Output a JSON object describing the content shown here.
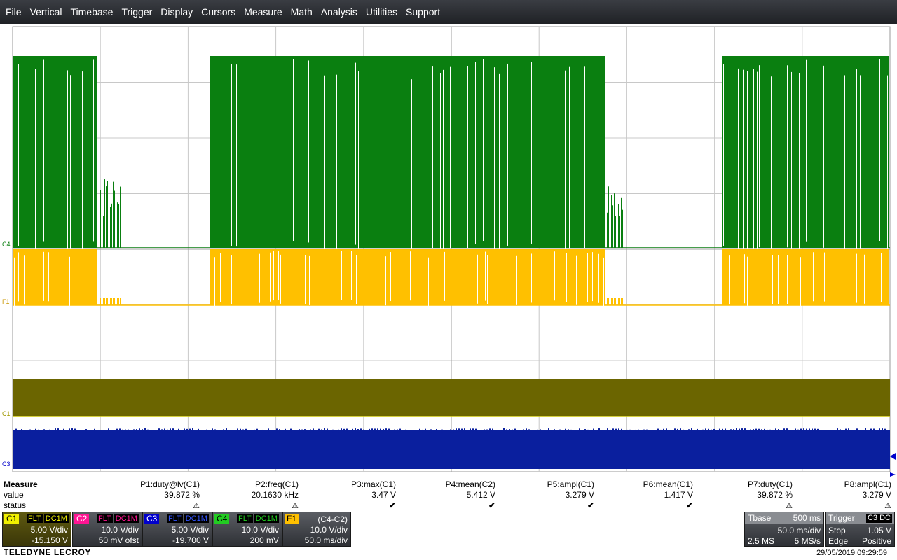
{
  "menu": [
    "File",
    "Vertical",
    "Timebase",
    "Trigger",
    "Display",
    "Cursors",
    "Measure",
    "Math",
    "Analysis",
    "Utilities",
    "Support"
  ],
  "trace_labels": {
    "c4": "C4",
    "f1": "F1",
    "c1": "C1",
    "c3": "C3"
  },
  "colors": {
    "c1": "#f0f000",
    "c2": "#ff1493",
    "c3": "#0000cc",
    "c4": "#0a7f10",
    "f1": "#ffc000",
    "olive": "#6b6500",
    "navy": "#0a1f9e"
  },
  "measure": {
    "title": "Measure",
    "value_label": "value",
    "status_label": "status",
    "params": [
      {
        "name": "P1:duty@lv(C1)",
        "value": "39.872 %",
        "status": "warn"
      },
      {
        "name": "P2:freq(C1)",
        "value": "20.1630 kHz",
        "status": "warn"
      },
      {
        "name": "P3:max(C1)",
        "value": "3.47 V",
        "status": "ok"
      },
      {
        "name": "P4:mean(C2)",
        "value": "5.412 V",
        "status": "ok"
      },
      {
        "name": "P5:ampl(C1)",
        "value": "3.279 V",
        "status": "ok"
      },
      {
        "name": "P6:mean(C1)",
        "value": "1.417 V",
        "status": "ok"
      },
      {
        "name": "P7:duty(C1)",
        "value": "39.872 %",
        "status": "warn"
      },
      {
        "name": "P8:ampl(C1)",
        "value": "3.279 V",
        "status": "warn"
      }
    ]
  },
  "channels": {
    "c1": {
      "tag": "C1",
      "flt": "FLT",
      "cpl": "DC1M",
      "vdiv": "5.00 V/div",
      "offset": "-15.150 V"
    },
    "c2": {
      "tag": "C2",
      "flt": "FLT",
      "cpl": "DC1M",
      "vdiv": "10.0 V/div",
      "offset": "50 mV ofst"
    },
    "c3": {
      "tag": "C3",
      "flt": "FLT",
      "cpl": "DC1M",
      "vdiv": "5.00 V/div",
      "offset": "-19.700 V"
    },
    "c4": {
      "tag": "C4",
      "flt": "FLT",
      "cpl": "DC1M",
      "vdiv": "10.0 V/div",
      "offset": "200 mV"
    },
    "f1": {
      "tag": "F1",
      "expr": "(C4-C2)",
      "vdiv": "10.0 V/div",
      "tdiv": "50.0 ms/div"
    }
  },
  "timebase": {
    "label": "Tbase",
    "value": "500 ms",
    "tdiv": "50.0 ms/div",
    "samples": "2.5 MS",
    "rate": "5 MS/s"
  },
  "trigger": {
    "label": "Trigger",
    "src": "C3",
    "cpl": "DC",
    "mode": "Stop",
    "level": "1.05 V",
    "type": "Edge",
    "slope": "Positive"
  },
  "brand": "TELEDYNE LECROY",
  "datetime": "29/05/2019 09:29:59"
}
